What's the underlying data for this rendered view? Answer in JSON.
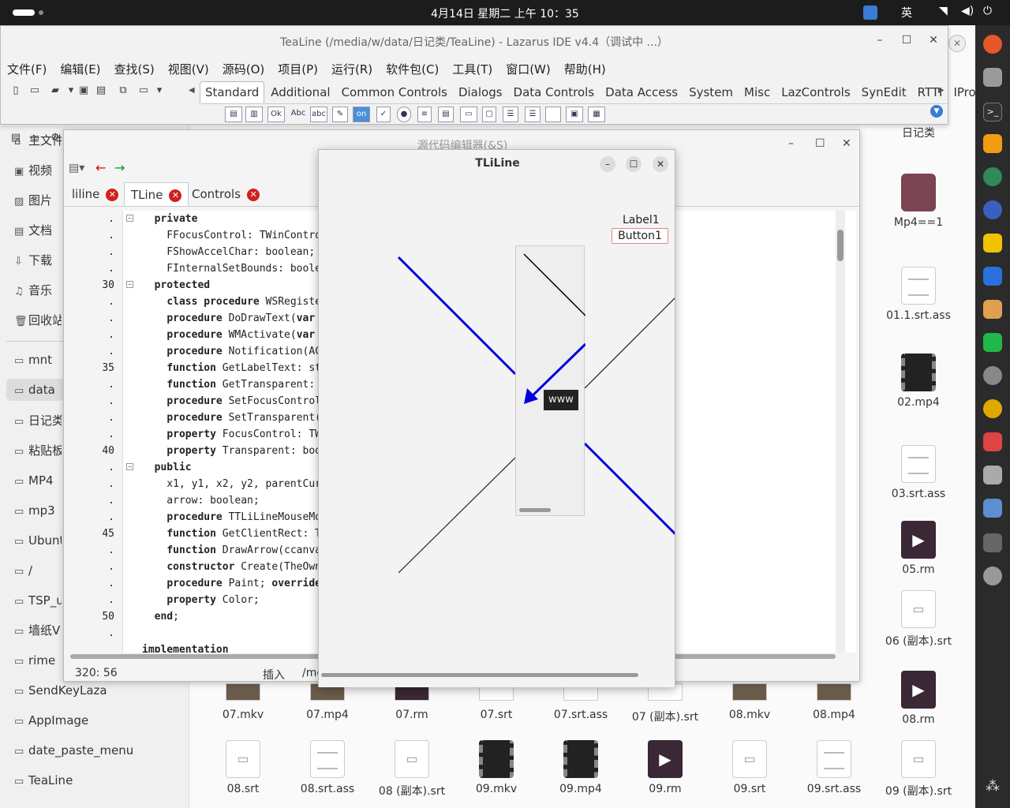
{
  "topbar": {
    "clock": "4月14日 星期二 上午 10：35",
    "ime": "英"
  },
  "ide": {
    "title": "TeaLine (/media/w/data/日记类/TeaLine) - Lazarus IDE v4.4（调试中 ...）",
    "menu": [
      "文件(F)",
      "编辑(E)",
      "查找(S)",
      "视图(V)",
      "源码(O)",
      "项目(P)",
      "运行(R)",
      "软件包(C)",
      "工具(T)",
      "窗口(W)",
      "帮助(H)"
    ],
    "palette_tabs": [
      "Standard",
      "Additional",
      "Common Controls",
      "Dialogs",
      "Data Controls",
      "Data Access",
      "System",
      "Misc",
      "LazControls",
      "SynEdit",
      "RTTI",
      "IPro"
    ]
  },
  "editor": {
    "title": "源代码编辑器(&S)",
    "tabs": [
      "liline",
      "TLine",
      "Controls"
    ],
    "gutter": [
      ".",
      ".",
      ".",
      ".",
      "30",
      ".",
      ".",
      ".",
      ".",
      "35",
      ".",
      ".",
      ".",
      ".",
      "40",
      ".",
      ".",
      ".",
      ".",
      "45",
      ".",
      ".",
      ".",
      ".",
      "50",
      "."
    ],
    "code": [
      "  private",
      "    FFocusControl: TWinControl",
      "    FShowAccelChar: boolean;",
      "    FInternalSetBounds: boolea",
      "  protected",
      "    class procedure WSRegister",
      "    procedure DoDrawText(var R",
      "    procedure WMActivate(var M",
      "    procedure Notification(ACo",
      "    function GetLabelText: str",
      "    function GetTransparent: b",
      "    procedure SetFocusControl(",
      "    procedure SetTransparent(N",
      "    property FocusControl: TWi",
      "    property Transparent: bool",
      "  public",
      "    x1, y1, x2, y2, parentCurs",
      "    arrow: boolean;",
      "    procedure TTLiLineMouseMov",
      "    function GetClientRect: TR",
      "    function DrawArrow(ccanvas",
      "    constructor Create(TheOwne",
      "    procedure Paint; override;",
      "    property Color;",
      "  end;",
      "",
      "implementation"
    ],
    "status_pos": "320: 56",
    "status_mode": "插入",
    "status_path": "/me"
  },
  "form": {
    "title": "TLiLine",
    "label1": "Label1",
    "button1": "Button1",
    "tooltip": "www"
  },
  "places": [
    "主文件夹",
    "视频",
    "图片",
    "文档",
    "下载",
    "音乐",
    "回收站",
    "mnt",
    "data",
    "日记类",
    "粘贴板",
    "MP4",
    "mp3",
    "Ubuntu",
    "/",
    "TSP_u",
    "墙纸V",
    "rime",
    "SendKeyLaza",
    "AppImage",
    "date_paste_menu",
    "TeaLine"
  ],
  "desktop_right": [
    {
      "name": "日记类",
      "kind": "text"
    },
    {
      "name": "Mp4==1",
      "kind": "folder"
    },
    {
      "name": "01.1.srt.ass",
      "kind": "doc"
    },
    {
      "name": "02.mp4",
      "kind": "vid"
    },
    {
      "name": "03.srt.ass",
      "kind": "doc"
    },
    {
      "name": "05.rm",
      "kind": "rm"
    },
    {
      "name": "06 (副本).srt",
      "kind": "srt"
    },
    {
      "name": "08.rm",
      "kind": "rm"
    }
  ],
  "files_row1": [
    "07.mkv",
    "07.mp4",
    "07.rm",
    "07.srt",
    "07.srt.ass",
    "07 (副本).srt",
    "08.mkv",
    "08.mp4"
  ],
  "files_row2": [
    {
      "name": "08.srt",
      "kind": "srt"
    },
    {
      "name": "08.srt.ass",
      "kind": "doc"
    },
    {
      "name": "08 (副本).srt",
      "kind": "srt"
    },
    {
      "name": "09.mkv",
      "kind": "vid"
    },
    {
      "name": "09.mp4",
      "kind": "vid"
    },
    {
      "name": "09.rm",
      "kind": "rm"
    },
    {
      "name": "09.srt",
      "kind": "srt"
    },
    {
      "name": "09.srt.ass",
      "kind": "doc"
    },
    {
      "name": "09 (副本).srt",
      "kind": "srt"
    }
  ],
  "colors": {
    "line_blue": "#0000dd",
    "close_red": "#d02020",
    "topbar": "#1c1c1c",
    "dock": "#2b2b2b"
  }
}
